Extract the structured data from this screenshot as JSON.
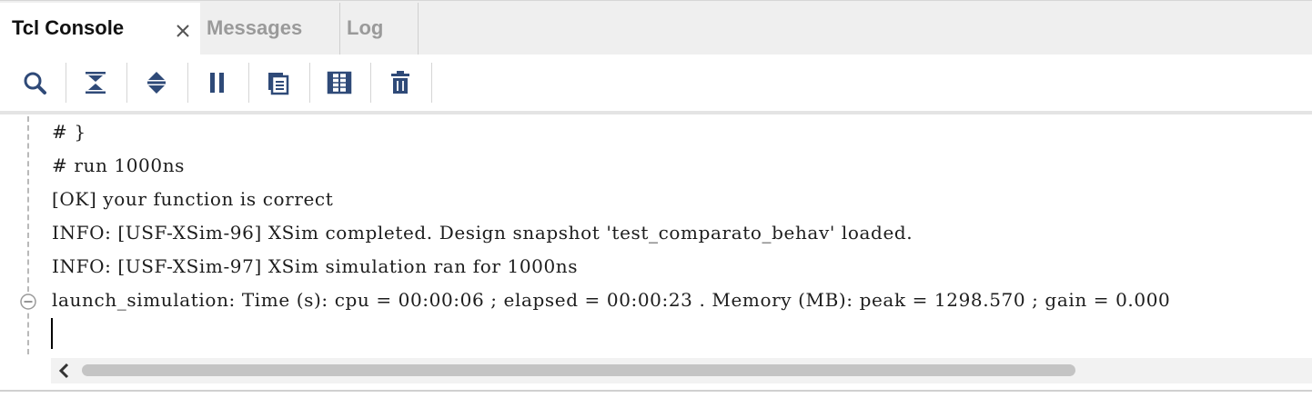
{
  "tabs": [
    {
      "label": "Tcl Console",
      "active": true,
      "closable": true,
      "close_glyph": "×"
    },
    {
      "label": "Messages",
      "active": false
    },
    {
      "label": "Log",
      "active": false
    }
  ],
  "toolbar": {
    "icons": [
      "search-icon",
      "collapse-all-icon",
      "expand-all-icon",
      "pause-icon",
      "copy-icon",
      "show-columns-icon",
      "delete-icon"
    ],
    "icon_color": "#2f4a78"
  },
  "console": {
    "lines": [
      "# }",
      "# run 1000ns",
      "[OK] your function is correct",
      "INFO: [USF-XSim-96] XSim completed. Design snapshot 'test_comparato_behav' loaded.",
      "INFO: [USF-XSim-97] XSim simulation ran for 1000ns",
      "launch_simulation: Time (s): cpu = 00:00:06 ; elapsed = 00:00:23 . Memory (MB): peak = 1298.570 ; gain = 0.000"
    ],
    "input_value": ""
  }
}
